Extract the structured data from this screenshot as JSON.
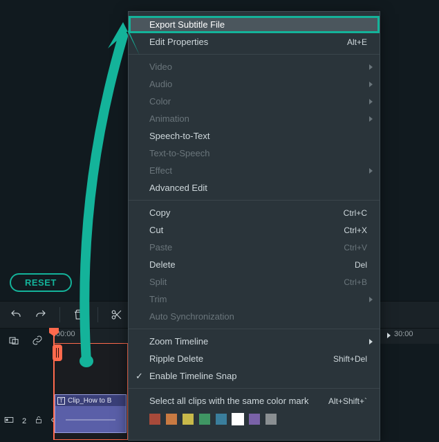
{
  "reset_label": "RESET",
  "ruler": {
    "start": ":00:00",
    "end": "30:00"
  },
  "clip": {
    "title": "Clip_How to B",
    "badge": "T"
  },
  "context_menu": {
    "highlighted": "Export Subtitle File",
    "groups": [
      [
        {
          "label": "Export Subtitle File",
          "hl": true
        },
        {
          "label": "Edit Properties",
          "sc": "Alt+E"
        }
      ],
      [
        {
          "label": "Video",
          "sub": true,
          "dis": true
        },
        {
          "label": "Audio",
          "sub": true,
          "dis": true
        },
        {
          "label": "Color",
          "sub": true,
          "dis": true
        },
        {
          "label": "Animation",
          "sub": true,
          "dis": true
        },
        {
          "label": "Speech-to-Text"
        },
        {
          "label": "Text-to-Speech",
          "dis": true
        },
        {
          "label": "Effect",
          "sub": true,
          "dis": true
        },
        {
          "label": "Advanced Edit"
        }
      ],
      [
        {
          "label": "Copy",
          "sc": "Ctrl+C"
        },
        {
          "label": "Cut",
          "sc": "Ctrl+X"
        },
        {
          "label": "Paste",
          "sc": "Ctrl+V",
          "dis": true
        },
        {
          "label": "Delete",
          "sc": "Del"
        },
        {
          "label": "Split",
          "sc": "Ctrl+B",
          "dis": true
        },
        {
          "label": "Trim",
          "sub": true,
          "dis": true
        },
        {
          "label": "Auto Synchronization",
          "dis": true
        }
      ],
      [
        {
          "label": "Zoom Timeline",
          "sub": true
        },
        {
          "label": "Ripple Delete",
          "sc": "Shift+Del"
        },
        {
          "label": "Enable Timeline Snap",
          "check": true
        }
      ],
      [
        {
          "label": "Select all clips with the same color mark",
          "sc": "Alt+Shift+`"
        }
      ]
    ],
    "swatches": [
      "#a84a3a",
      "#c97a42",
      "#c8b94a",
      "#3f9663",
      "#3a7e9c",
      "#ffffff",
      "#7a62a8",
      "#8a8f92"
    ],
    "selected_swatch": 5
  },
  "annotation": {
    "color": "#14b39a"
  }
}
